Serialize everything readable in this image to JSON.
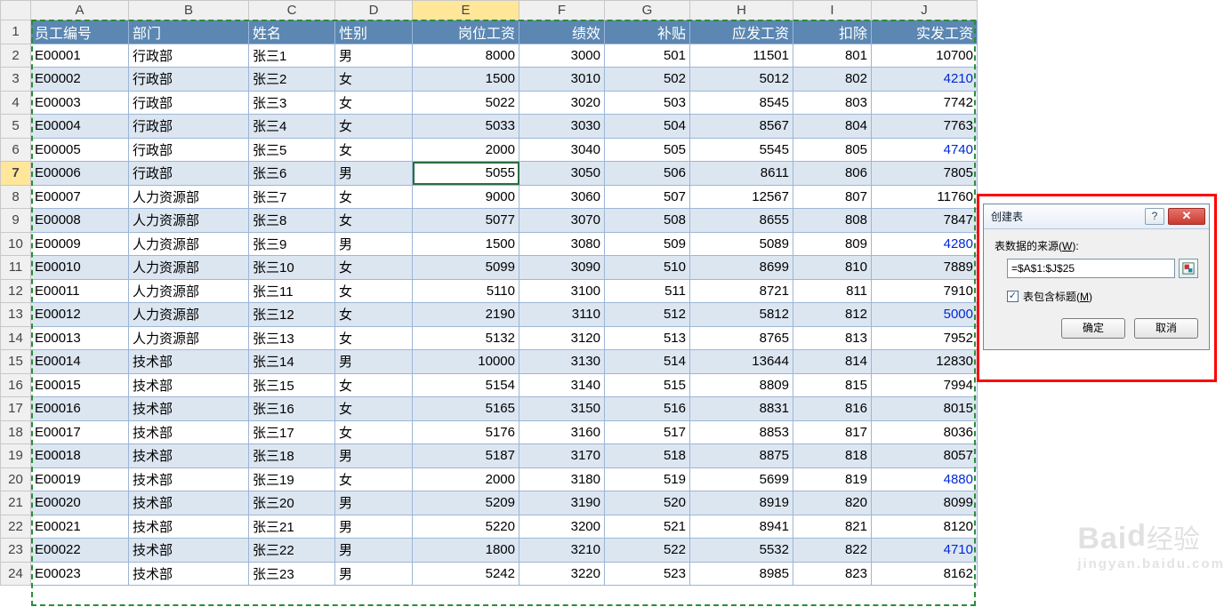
{
  "columns": [
    "A",
    "B",
    "C",
    "D",
    "E",
    "F",
    "G",
    "H",
    "I",
    "J"
  ],
  "selectedCol": "E",
  "selectedRow": 7,
  "activeCell": {
    "row": 7,
    "col": "E"
  },
  "header": {
    "A": "员工编号",
    "B": "部门",
    "C": "姓名",
    "D": "性别",
    "E": "岗位工资",
    "F": "绩效",
    "G": "补贴",
    "H": "应发工资",
    "I": "扣除",
    "J": "实发工资"
  },
  "columnAlign": {
    "A": "txt",
    "B": "txt",
    "C": "txt",
    "D": "txt",
    "E": "num",
    "F": "num",
    "G": "num",
    "H": "num",
    "I": "num",
    "J": "num"
  },
  "blueCells": [
    [
      3,
      "J"
    ],
    [
      6,
      "J"
    ],
    [
      10,
      "J"
    ],
    [
      13,
      "J"
    ],
    [
      20,
      "J"
    ],
    [
      23,
      "J"
    ]
  ],
  "rows": [
    {
      "r": 2,
      "A": "E00001",
      "B": "行政部",
      "C": "张三1",
      "D": "男",
      "E": "8000",
      "F": "3000",
      "G": "501",
      "H": "11501",
      "I": "801",
      "J": "10700"
    },
    {
      "r": 3,
      "A": "E00002",
      "B": "行政部",
      "C": "张三2",
      "D": "女",
      "E": "1500",
      "F": "3010",
      "G": "502",
      "H": "5012",
      "I": "802",
      "J": "4210"
    },
    {
      "r": 4,
      "A": "E00003",
      "B": "行政部",
      "C": "张三3",
      "D": "女",
      "E": "5022",
      "F": "3020",
      "G": "503",
      "H": "8545",
      "I": "803",
      "J": "7742"
    },
    {
      "r": 5,
      "A": "E00004",
      "B": "行政部",
      "C": "张三4",
      "D": "女",
      "E": "5033",
      "F": "3030",
      "G": "504",
      "H": "8567",
      "I": "804",
      "J": "7763"
    },
    {
      "r": 6,
      "A": "E00005",
      "B": "行政部",
      "C": "张三5",
      "D": "女",
      "E": "2000",
      "F": "3040",
      "G": "505",
      "H": "5545",
      "I": "805",
      "J": "4740"
    },
    {
      "r": 7,
      "A": "E00006",
      "B": "行政部",
      "C": "张三6",
      "D": "男",
      "E": "5055",
      "F": "3050",
      "G": "506",
      "H": "8611",
      "I": "806",
      "J": "7805"
    },
    {
      "r": 8,
      "A": "E00007",
      "B": "人力资源部",
      "C": "张三7",
      "D": "女",
      "E": "9000",
      "F": "3060",
      "G": "507",
      "H": "12567",
      "I": "807",
      "J": "11760"
    },
    {
      "r": 9,
      "A": "E00008",
      "B": "人力资源部",
      "C": "张三8",
      "D": "女",
      "E": "5077",
      "F": "3070",
      "G": "508",
      "H": "8655",
      "I": "808",
      "J": "7847"
    },
    {
      "r": 10,
      "A": "E00009",
      "B": "人力资源部",
      "C": "张三9",
      "D": "男",
      "E": "1500",
      "F": "3080",
      "G": "509",
      "H": "5089",
      "I": "809",
      "J": "4280"
    },
    {
      "r": 11,
      "A": "E00010",
      "B": "人力资源部",
      "C": "张三10",
      "D": "女",
      "E": "5099",
      "F": "3090",
      "G": "510",
      "H": "8699",
      "I": "810",
      "J": "7889"
    },
    {
      "r": 12,
      "A": "E00011",
      "B": "人力资源部",
      "C": "张三11",
      "D": "女",
      "E": "5110",
      "F": "3100",
      "G": "511",
      "H": "8721",
      "I": "811",
      "J": "7910"
    },
    {
      "r": 13,
      "A": "E00012",
      "B": "人力资源部",
      "C": "张三12",
      "D": "女",
      "E": "2190",
      "F": "3110",
      "G": "512",
      "H": "5812",
      "I": "812",
      "J": "5000"
    },
    {
      "r": 14,
      "A": "E00013",
      "B": "人力资源部",
      "C": "张三13",
      "D": "女",
      "E": "5132",
      "F": "3120",
      "G": "513",
      "H": "8765",
      "I": "813",
      "J": "7952"
    },
    {
      "r": 15,
      "A": "E00014",
      "B": "技术部",
      "C": "张三14",
      "D": "男",
      "E": "10000",
      "F": "3130",
      "G": "514",
      "H": "13644",
      "I": "814",
      "J": "12830"
    },
    {
      "r": 16,
      "A": "E00015",
      "B": "技术部",
      "C": "张三15",
      "D": "女",
      "E": "5154",
      "F": "3140",
      "G": "515",
      "H": "8809",
      "I": "815",
      "J": "7994"
    },
    {
      "r": 17,
      "A": "E00016",
      "B": "技术部",
      "C": "张三16",
      "D": "女",
      "E": "5165",
      "F": "3150",
      "G": "516",
      "H": "8831",
      "I": "816",
      "J": "8015"
    },
    {
      "r": 18,
      "A": "E00017",
      "B": "技术部",
      "C": "张三17",
      "D": "女",
      "E": "5176",
      "F": "3160",
      "G": "517",
      "H": "8853",
      "I": "817",
      "J": "8036"
    },
    {
      "r": 19,
      "A": "E00018",
      "B": "技术部",
      "C": "张三18",
      "D": "男",
      "E": "5187",
      "F": "3170",
      "G": "518",
      "H": "8875",
      "I": "818",
      "J": "8057"
    },
    {
      "r": 20,
      "A": "E00019",
      "B": "技术部",
      "C": "张三19",
      "D": "女",
      "E": "2000",
      "F": "3180",
      "G": "519",
      "H": "5699",
      "I": "819",
      "J": "4880"
    },
    {
      "r": 21,
      "A": "E00020",
      "B": "技术部",
      "C": "张三20",
      "D": "男",
      "E": "5209",
      "F": "3190",
      "G": "520",
      "H": "8919",
      "I": "820",
      "J": "8099"
    },
    {
      "r": 22,
      "A": "E00021",
      "B": "技术部",
      "C": "张三21",
      "D": "男",
      "E": "5220",
      "F": "3200",
      "G": "521",
      "H": "8941",
      "I": "821",
      "J": "8120"
    },
    {
      "r": 23,
      "A": "E00022",
      "B": "技术部",
      "C": "张三22",
      "D": "男",
      "E": "1800",
      "F": "3210",
      "G": "522",
      "H": "5532",
      "I": "822",
      "J": "4710"
    },
    {
      "r": 24,
      "A": "E00023",
      "B": "技术部",
      "C": "张三23",
      "D": "男",
      "E": "5242",
      "F": "3220",
      "G": "523",
      "H": "8985",
      "I": "823",
      "J": "8162"
    }
  ],
  "dialog": {
    "title": "创建表",
    "sourceLabelPrefix": "表数据的来源(",
    "sourceLabelKey": "W",
    "sourceLabelSuffix": "):",
    "sourceValue": "=$A$1:$J$25",
    "checkboxLabelPrefix": "表包含标题(",
    "checkboxLabelKey": "M",
    "checkboxLabelSuffix": ")",
    "checkboxChecked": true,
    "ok": "确定",
    "cancel": "取消",
    "help": "?",
    "close": "✕"
  },
  "watermark": {
    "brand_a": "Bai",
    "brand_b": "d",
    "brand_c": "经验",
    "url": "jingyan.baidu.com"
  }
}
